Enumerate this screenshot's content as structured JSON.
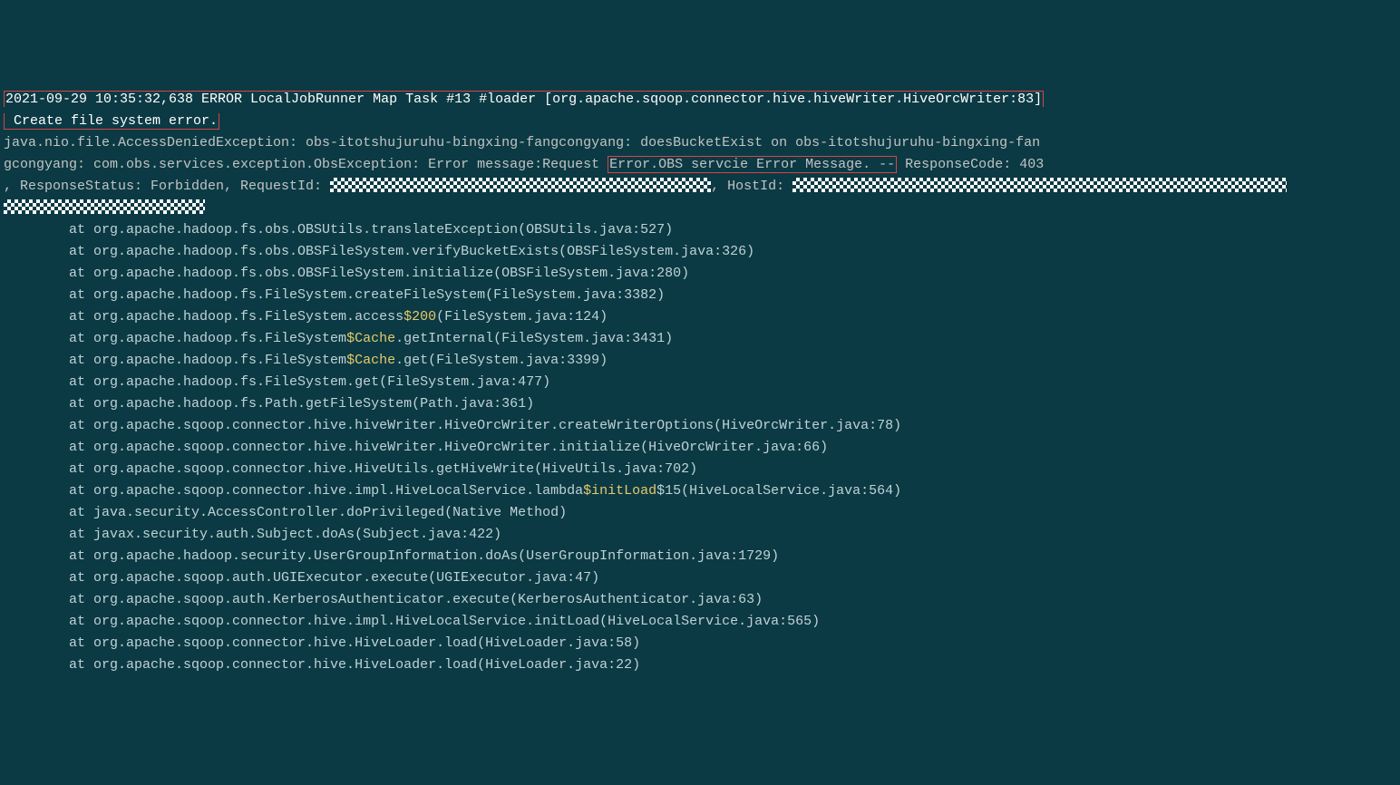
{
  "line1_boxed": "2021-09-29 10:35:32,638 ERROR LocalJobRunner Map Task #13 #loader [org.apache.sqoop.connector.hive.hiveWriter.HiveOrcWriter:83]",
  "line2_boxed": " Create file system error.",
  "ex1_a": "java.nio.file.AccessDeniedException: obs-itotshujuruhu-bingxing-fangcongyang: doesBucketExist on obs-itotshujuruhu-bingxing-fan",
  "ex2_a": "gcongyang: com.obs.services.exception.ObsException: Error message:Request ",
  "ex2_box": "Error.OBS servcie Error Message. --",
  "ex2_c": " ResponseCode: 403",
  "ex3_a": ", ResponseStatus: Forbidden, RequestId: ",
  "ex3_b": ", HostId: ",
  "st": [
    {
      "pre": "        at org.apache.hadoop.fs.obs.OBSUtils.translateException(OBSUtils.java:527)"
    },
    {
      "pre": "        at org.apache.hadoop.fs.obs.OBSFileSystem.verifyBucketExists(OBSFileSystem.java:326)"
    },
    {
      "pre": "        at org.apache.hadoop.fs.obs.OBSFileSystem.initialize(OBSFileSystem.java:280)"
    },
    {
      "pre": "        at org.apache.hadoop.fs.FileSystem.createFileSystem(FileSystem.java:3382)"
    },
    {
      "pre": "        at org.apache.hadoop.fs.FileSystem.access",
      "gold": "$200",
      "post": "(FileSystem.java:124)"
    },
    {
      "pre": "        at org.apache.hadoop.fs.FileSystem",
      "gold": "$Cache",
      "post": ".getInternal(FileSystem.java:3431)"
    },
    {
      "pre": "        at org.apache.hadoop.fs.FileSystem",
      "gold": "$Cache",
      "post": ".get(FileSystem.java:3399)"
    },
    {
      "pre": "        at org.apache.hadoop.fs.FileSystem.get(FileSystem.java:477)"
    },
    {
      "pre": "        at org.apache.hadoop.fs.Path.getFileSystem(Path.java:361)"
    },
    {
      "pre": "        at org.apache.sqoop.connector.hive.hiveWriter.HiveOrcWriter.createWriterOptions(HiveOrcWriter.java:78)"
    },
    {
      "pre": "        at org.apache.sqoop.connector.hive.hiveWriter.HiveOrcWriter.initialize(HiveOrcWriter.java:66)"
    },
    {
      "pre": "        at org.apache.sqoop.connector.hive.HiveUtils.getHiveWrite(HiveUtils.java:702)"
    },
    {
      "pre": "        at org.apache.sqoop.connector.hive.impl.HiveLocalService.lambda",
      "gold": "$initLoad",
      "post": "$15(HiveLocalService.java:564)"
    },
    {
      "pre": "        at java.security.AccessController.doPrivileged(Native Method)"
    },
    {
      "pre": "        at javax.security.auth.Subject.doAs(Subject.java:422)"
    },
    {
      "pre": "        at org.apache.hadoop.security.UserGroupInformation.doAs(UserGroupInformation.java:1729)"
    },
    {
      "pre": "        at org.apache.sqoop.auth.UGIExecutor.execute(UGIExecutor.java:47)"
    },
    {
      "pre": "        at org.apache.sqoop.auth.KerberosAuthenticator.execute(KerberosAuthenticator.java:63)"
    },
    {
      "pre": "        at org.apache.sqoop.connector.hive.impl.HiveLocalService.initLoad(HiveLocalService.java:565)"
    },
    {
      "pre": "        at org.apache.sqoop.connector.hive.HiveLoader.load(HiveLoader.java:58)"
    },
    {
      "pre": "        at org.apache.sqoop.connector.hive.HiveLoader.load(HiveLoader.java:22)"
    }
  ]
}
